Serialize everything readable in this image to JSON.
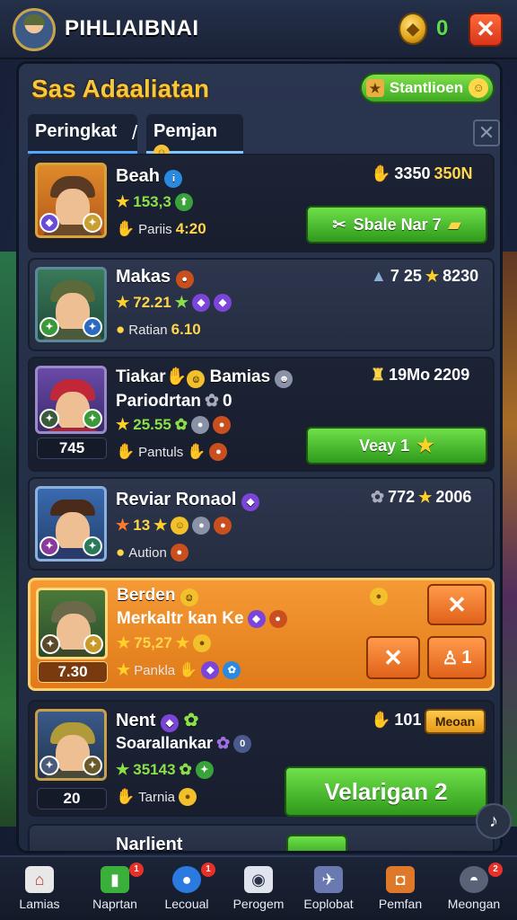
{
  "header": {
    "player_name": "PIHLIAIBNAI",
    "gem_count": "0",
    "close_label": "✕"
  },
  "panel": {
    "title": "Sas Adaaliatan",
    "top_button": "Stantlioen",
    "tabs": [
      {
        "label": "Peringkat"
      },
      {
        "label": "Pemjan"
      }
    ],
    "tab_separator": "/",
    "tab_close": "✕"
  },
  "rows": [
    {
      "name": "Beah",
      "rating": "153,3",
      "sub_label": "Pariis",
      "sub_value": "4:20",
      "right_stat_a": "3350",
      "right_stat_b": "350N",
      "button_label": "Sbale Nar 7"
    },
    {
      "name": "Makas",
      "rating": "72.21",
      "sub_label": "Ratian",
      "sub_value": "6.10",
      "right_stat_a": "7 25",
      "right_stat_b": "8230"
    },
    {
      "name": "Tiakar",
      "name_extra": "Bamias",
      "line2": "Pariodrtan",
      "line2_value": "0",
      "rating": "25.55",
      "score": "745",
      "sub_label": "Pantuls",
      "right_stat_a": "19Mo",
      "right_stat_b": "2209",
      "button_label": "Veay 1"
    },
    {
      "name": "Reviar Ronaol",
      "rating": "13",
      "sub_label": "Aution",
      "right_stat_a": "772",
      "right_stat_b": "2006"
    },
    {
      "name": "Berden",
      "line2": "Merkaltr kan Ke",
      "rating": "75,27",
      "score": "7.30",
      "sub_label": "Pankla",
      "btn_x": "✕",
      "btn_small": "1"
    },
    {
      "name": "Nent",
      "line2": "Soarallankar",
      "line2_value": "0",
      "rating": "35143",
      "score": "20",
      "sub_label": "Tarnia",
      "right_stat_a": "101",
      "mini_button": "Meoan",
      "button_label": "Velarigan 2"
    },
    {
      "name": "Narlient"
    }
  ],
  "nav": [
    {
      "label": "Lamias",
      "icon": "home-icon"
    },
    {
      "label": "Naprtan",
      "icon": "card-icon",
      "badge": "1"
    },
    {
      "label": "Lecoual",
      "icon": "ball-icon",
      "badge": "1"
    },
    {
      "label": "Perogem",
      "icon": "camera-icon"
    },
    {
      "label": "Eoplobat",
      "icon": "map-icon"
    },
    {
      "label": "Pemfan",
      "icon": "chest-icon"
    },
    {
      "label": "Meongan",
      "icon": "helmet-icon",
      "badge": "2"
    }
  ],
  "colors": {
    "accent_green": "#4cc22e",
    "accent_orange": "#ef8a26",
    "title_gold": "#f7c83b"
  }
}
